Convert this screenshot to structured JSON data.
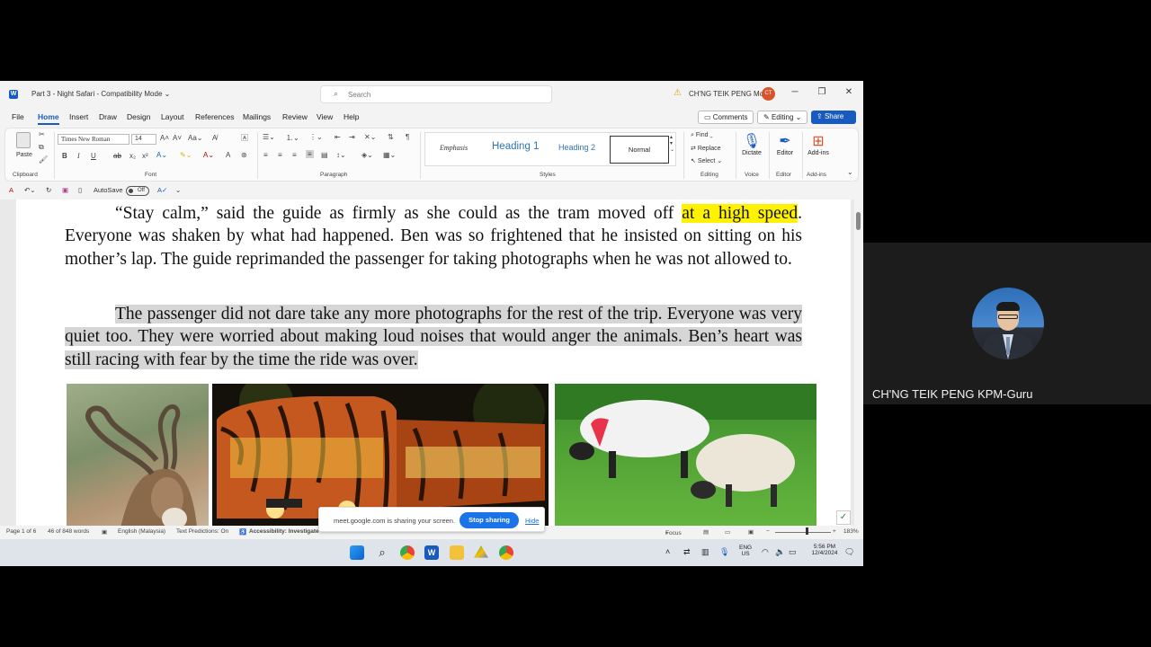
{
  "window": {
    "doc_title": "Part 3 - Night Safari  -  Compatibility Mode ⌄",
    "search_placeholder": "Search",
    "user_name": "CH'NG TEIK PENG Moe",
    "user_initials": "CT"
  },
  "tabs": [
    "File",
    "Home",
    "Insert",
    "Draw",
    "Design",
    "Layout",
    "References",
    "Mailings",
    "Review",
    "View",
    "Help"
  ],
  "top_buttons": {
    "comments": "Comments",
    "editing": "Editing ⌄",
    "share": "Share"
  },
  "ribbon": {
    "paste": "Paste",
    "font_name": "Times New Roman",
    "font_size": "14",
    "groups": {
      "clipboard": "Clipboard",
      "font": "Font",
      "paragraph": "Paragraph",
      "styles": "Styles",
      "editing": "Editing",
      "voice": "Voice",
      "editor": "Editor",
      "addins": "Add-ins"
    },
    "styles": {
      "emphasis": "Emphasis",
      "heading1": "Heading 1",
      "heading2": "Heading 2",
      "normal": "Normal"
    },
    "editing": {
      "find": "Find ⌄",
      "replace": "Replace",
      "select": "Select ⌄"
    },
    "dictate": "Dictate",
    "editor": "Editor",
    "addins": "Add-ins"
  },
  "qat": {
    "autosave": "AutoSave",
    "autosave_state": "Off"
  },
  "document": {
    "p1_before": "“Stay calm,” said the guide as firmly as she could as the tram moved off ",
    "p1_highlight": "at a high speed",
    "p1_after": ". Everyone was shaken by what had happened. Ben was so frightened that he insisted on sitting on his mother’s lap. The guide reprimanded the passenger for taking photographs when he was not allowed to.",
    "p2": "The passenger did not dare take any more photographs for the rest of the trip. Everyone was very quiet too. They were worried about making loud noises that would anger the animals. Ben’s heart was still racing with fear by the time the ride was over."
  },
  "status": {
    "page": "Page 1 of 6",
    "words": "46 of 848 words",
    "language": "English (Malaysia)",
    "predictions": "Text Predictions: On",
    "accessibility": "Accessibility: Investigate",
    "focus": "Focus",
    "zoom": "183%"
  },
  "share_banner": {
    "message": "meet.google.com is sharing your screen.",
    "stop": "Stop sharing",
    "hide": "Hide"
  },
  "taskbar": {
    "lang1": "ENG",
    "lang2": "US",
    "time": "5:56 PM",
    "date": "12/4/2024"
  },
  "participant": {
    "name": "CH'NG TEIK PENG KPM-Guru"
  },
  "colors": {
    "word_blue": "#185abd",
    "highlight": "#fff200",
    "selection": "#d6d6d6",
    "meet_blue": "#1a73e8"
  }
}
